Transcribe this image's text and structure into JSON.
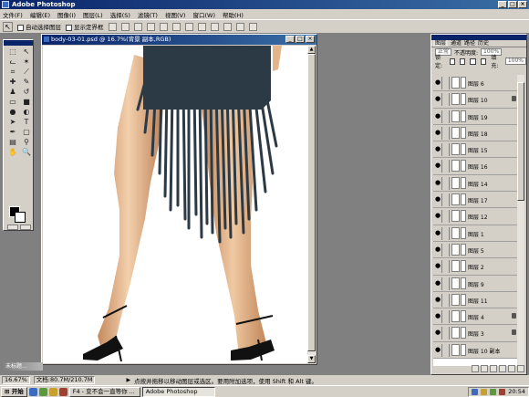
{
  "app": {
    "title": "Adobe Photoshop"
  },
  "menu": [
    "文件(F)",
    "编辑(E)",
    "图像(I)",
    "图层(L)",
    "选择(S)",
    "滤镜(T)",
    "视图(V)",
    "窗口(W)",
    "帮助(H)"
  ],
  "options": {
    "auto_select_label": "自动选择图层",
    "show_bounds_label": "显示定界框"
  },
  "document": {
    "title": "body-03-01.psd @ 16.7%(背景 副本,RGB)"
  },
  "mini_doc": {
    "label": "未标题..."
  },
  "layers_panel": {
    "tabs": [
      "图层",
      "通道",
      "路径",
      "历史"
    ],
    "blend_mode": "正常",
    "opacity_label": "不透明度:",
    "opacity_value": "100%",
    "lock_label": "锁定:",
    "fill_label": "填充:",
    "fill_value": "100%",
    "layers": [
      {
        "name": "图层 6",
        "locked": false
      },
      {
        "name": "图层 10",
        "locked": true
      },
      {
        "name": "图层 19",
        "locked": false
      },
      {
        "name": "图层 18",
        "locked": false
      },
      {
        "name": "图层 15",
        "locked": false
      },
      {
        "name": "图层 16",
        "locked": false
      },
      {
        "name": "图层 14",
        "locked": false
      },
      {
        "name": "图层 17",
        "locked": false
      },
      {
        "name": "图层 12",
        "locked": false
      },
      {
        "name": "图层 1",
        "locked": false
      },
      {
        "name": "图层 5",
        "locked": false
      },
      {
        "name": "图层 2",
        "locked": false
      },
      {
        "name": "图层 9",
        "locked": false
      },
      {
        "name": "图层 11",
        "locked": false
      },
      {
        "name": "图层 4",
        "locked": true
      },
      {
        "name": "图层 3",
        "locked": true
      },
      {
        "name": "图层 10 副本",
        "locked": false
      }
    ]
  },
  "status": {
    "zoom": "16.67%",
    "doc_size": "文档:80.7M/210.7M",
    "hint": "点按并拖移以移动图层或选区。要用附加选项，使用 Shift 和 Alt 键。"
  },
  "taskbar": {
    "start_label": "开始",
    "task1": "F4 - 变不会一直等你 ...",
    "task2": "Adobe Photoshop",
    "clock": "20:54"
  },
  "colors": {
    "title_gradient_start": "#0a246a",
    "title_gradient_end": "#3a6ea5",
    "chrome": "#d4d0c8",
    "workspace": "#808080",
    "skirt": "#2b3a45",
    "skin": "#d9a57c"
  }
}
